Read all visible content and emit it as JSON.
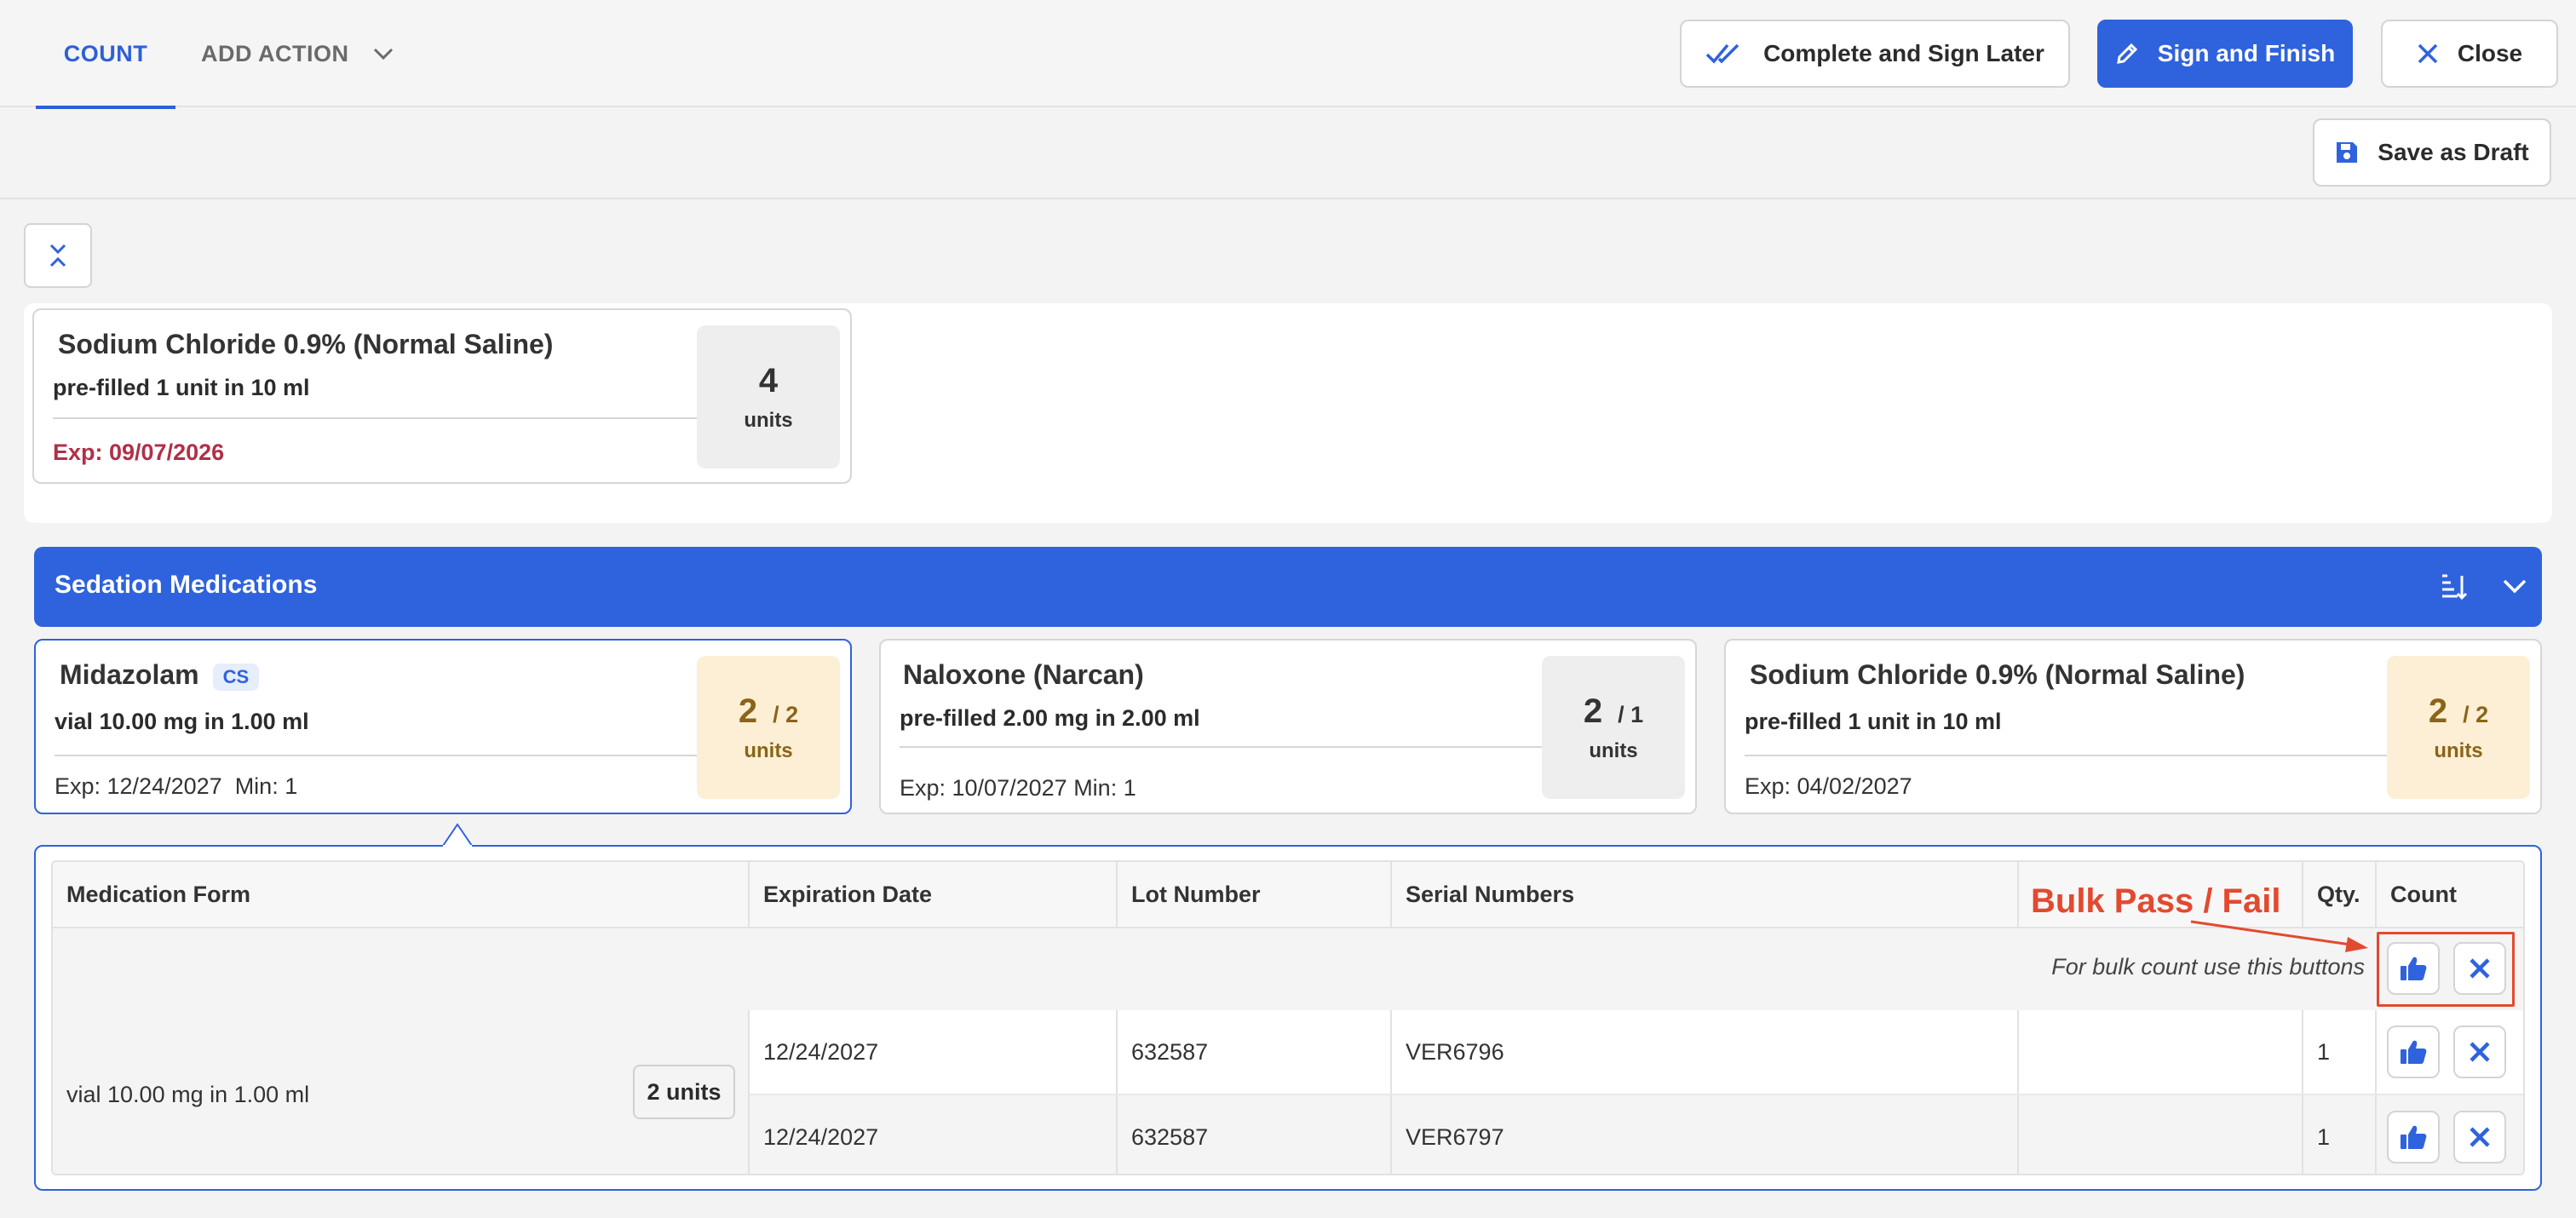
{
  "tabs": [
    {
      "label": "COUNT",
      "active": true
    },
    {
      "label": "ADD ACTION",
      "active": false
    }
  ],
  "header_buttons": {
    "complete_later": "Complete and Sign Later",
    "sign_finish": "Sign and Finish",
    "close": "Close",
    "save_draft": "Save as Draft"
  },
  "top_group": {
    "card": {
      "name": "Sodium Chloride 0.9% (Normal Saline)",
      "description": "pre-filled 1 unit in 10 ml",
      "expiry": "Exp: 09/07/2026",
      "count": "4",
      "unit": "units"
    }
  },
  "section": {
    "title": "Sedation Medications",
    "icons": [
      "sort-icon",
      "chevron-down-icon"
    ]
  },
  "cards": [
    {
      "name": "Midazolam",
      "badge": "CS",
      "description": "vial 10.00 mg in 1.00 ml",
      "expiry": "Exp: 12/24/2027",
      "min": "Min: 1",
      "count": "2",
      "total": "/ 2",
      "unit": "units",
      "selected": true
    },
    {
      "name": "Naloxone (Narcan)",
      "description": "pre-filled 2.00 mg in 2.00 ml",
      "expiry": "Exp: 10/07/2027",
      "min": "Min: 1",
      "count": "2",
      "total": "/ 1",
      "unit": "units",
      "selected": false
    },
    {
      "name": "Sodium Chloride 0.9% (Normal Saline)",
      "description": "pre-filled 1 unit in 10 ml",
      "expiry": "Exp: 04/02/2027",
      "count": "2",
      "total": "/ 2",
      "unit": "units",
      "selected": false
    }
  ],
  "table": {
    "headers": [
      "Medication Form",
      "Expiration Date",
      "Lot Number",
      "Serial Numbers",
      "",
      "Qty.",
      "Count"
    ],
    "bulk_hint": "For bulk count use this buttons",
    "medication_form": "vial 10.00 mg in 1.00 ml",
    "form_units": "2 units",
    "rows": [
      {
        "expiration": "12/24/2027",
        "lot": "632587",
        "serial": "VER6796",
        "qty": "1"
      },
      {
        "expiration": "12/24/2027",
        "lot": "632587",
        "serial": "VER6797",
        "qty": "1"
      }
    ]
  },
  "annotation": {
    "text": "Bulk Pass / Fail"
  },
  "colors": {
    "primary": "#2f62dd",
    "amber_bg": "#fdefd5",
    "expiry_red": "#b03047",
    "annotation": "#e24a2f"
  }
}
